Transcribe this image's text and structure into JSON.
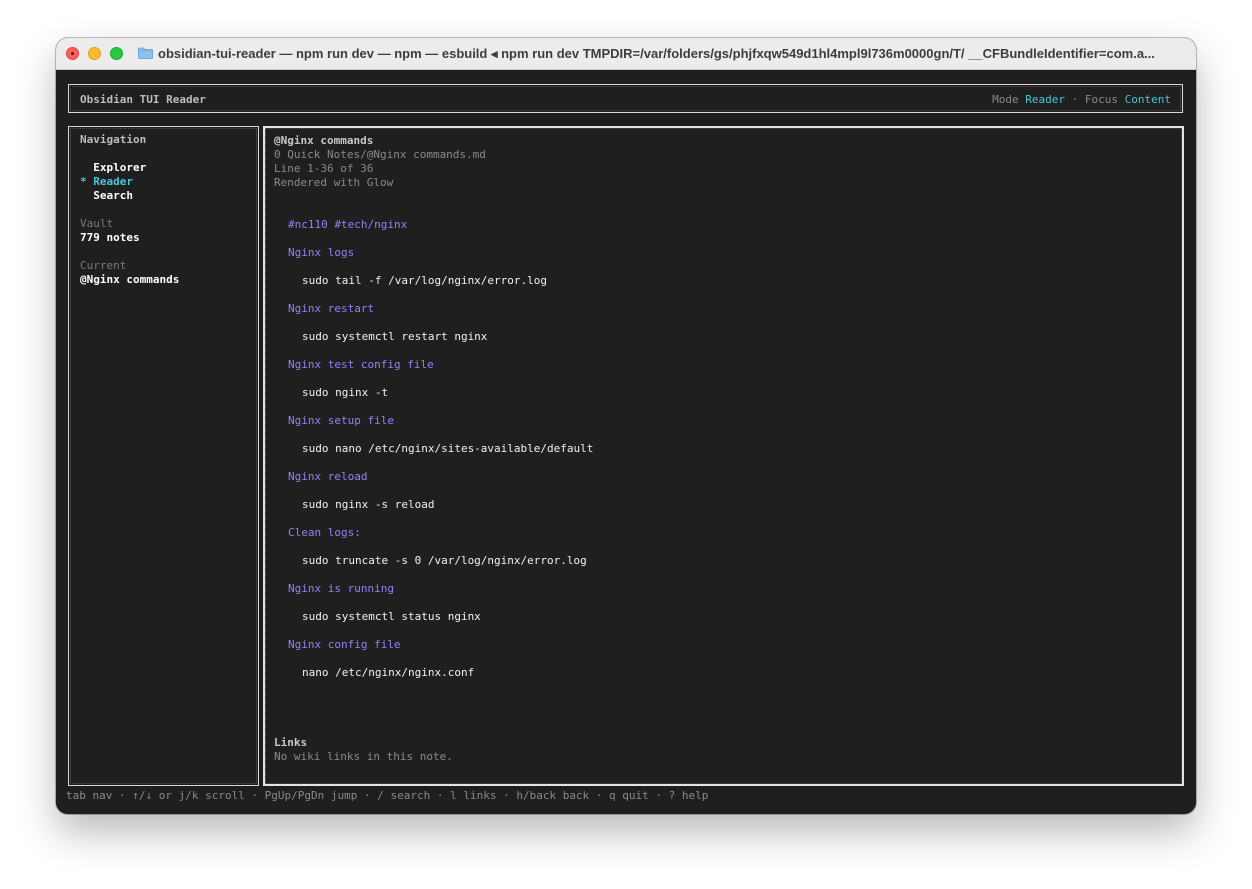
{
  "window": {
    "title": "obsidian-tui-reader — npm run dev — npm — esbuild ◂ npm run dev TMPDIR=/var/folders/gs/phjfxqw549d1hl4mpl9l736m0000gn/T/ __CFBundleIdentifier=com.a..."
  },
  "header": {
    "app_title": "Obsidian TUI Reader",
    "mode_label": "Mode",
    "mode_value": "Reader",
    "separator": "·",
    "focus_label": "Focus",
    "focus_value": "Content"
  },
  "nav": {
    "title": "Navigation",
    "items": [
      {
        "marker": " ",
        "label": "Explorer",
        "active": false
      },
      {
        "marker": "*",
        "label": "Reader",
        "active": true
      },
      {
        "marker": " ",
        "label": "Search",
        "active": false
      }
    ],
    "vault_label": "Vault",
    "vault_value": "779 notes",
    "current_label": "Current",
    "current_value": "@Nginx commands"
  },
  "content": {
    "title": "@Nginx commands",
    "path": "0 Quick Notes/@Nginx commands.md",
    "line_info": "Line 1-36 of 36",
    "renderer": "Rendered with Glow",
    "tags": "#nc110 #tech/nginx",
    "sections": [
      {
        "heading": "Nginx logs",
        "command": "sudo tail -f /var/log/nginx/error.log"
      },
      {
        "heading": "Nginx restart",
        "command": "sudo systemctl restart nginx"
      },
      {
        "heading": "Nginx test config file",
        "command": "sudo nginx -t"
      },
      {
        "heading": "Nginx setup file",
        "command": "sudo nano /etc/nginx/sites-available/default"
      },
      {
        "heading": "Nginx reload",
        "command": "sudo nginx -s reload"
      },
      {
        "heading": "Clean logs:",
        "command": "sudo truncate -s 0 /var/log/nginx/error.log"
      },
      {
        "heading": "Nginx is running",
        "command": "sudo systemctl status nginx"
      },
      {
        "heading": "Nginx config file",
        "command": "nano /etc/nginx/nginx.conf"
      }
    ],
    "links_title": "Links",
    "links_empty": "No wiki links in this note."
  },
  "footer": {
    "hints": "tab nav · ↑/↓ or j/k scroll · PgUp/PgDn jump · / search · l links · h/back back · q quit · ? help"
  },
  "colors": {
    "accent": "#49c6d8",
    "heading": "#8b86f5",
    "background": "#1f1f1f"
  }
}
